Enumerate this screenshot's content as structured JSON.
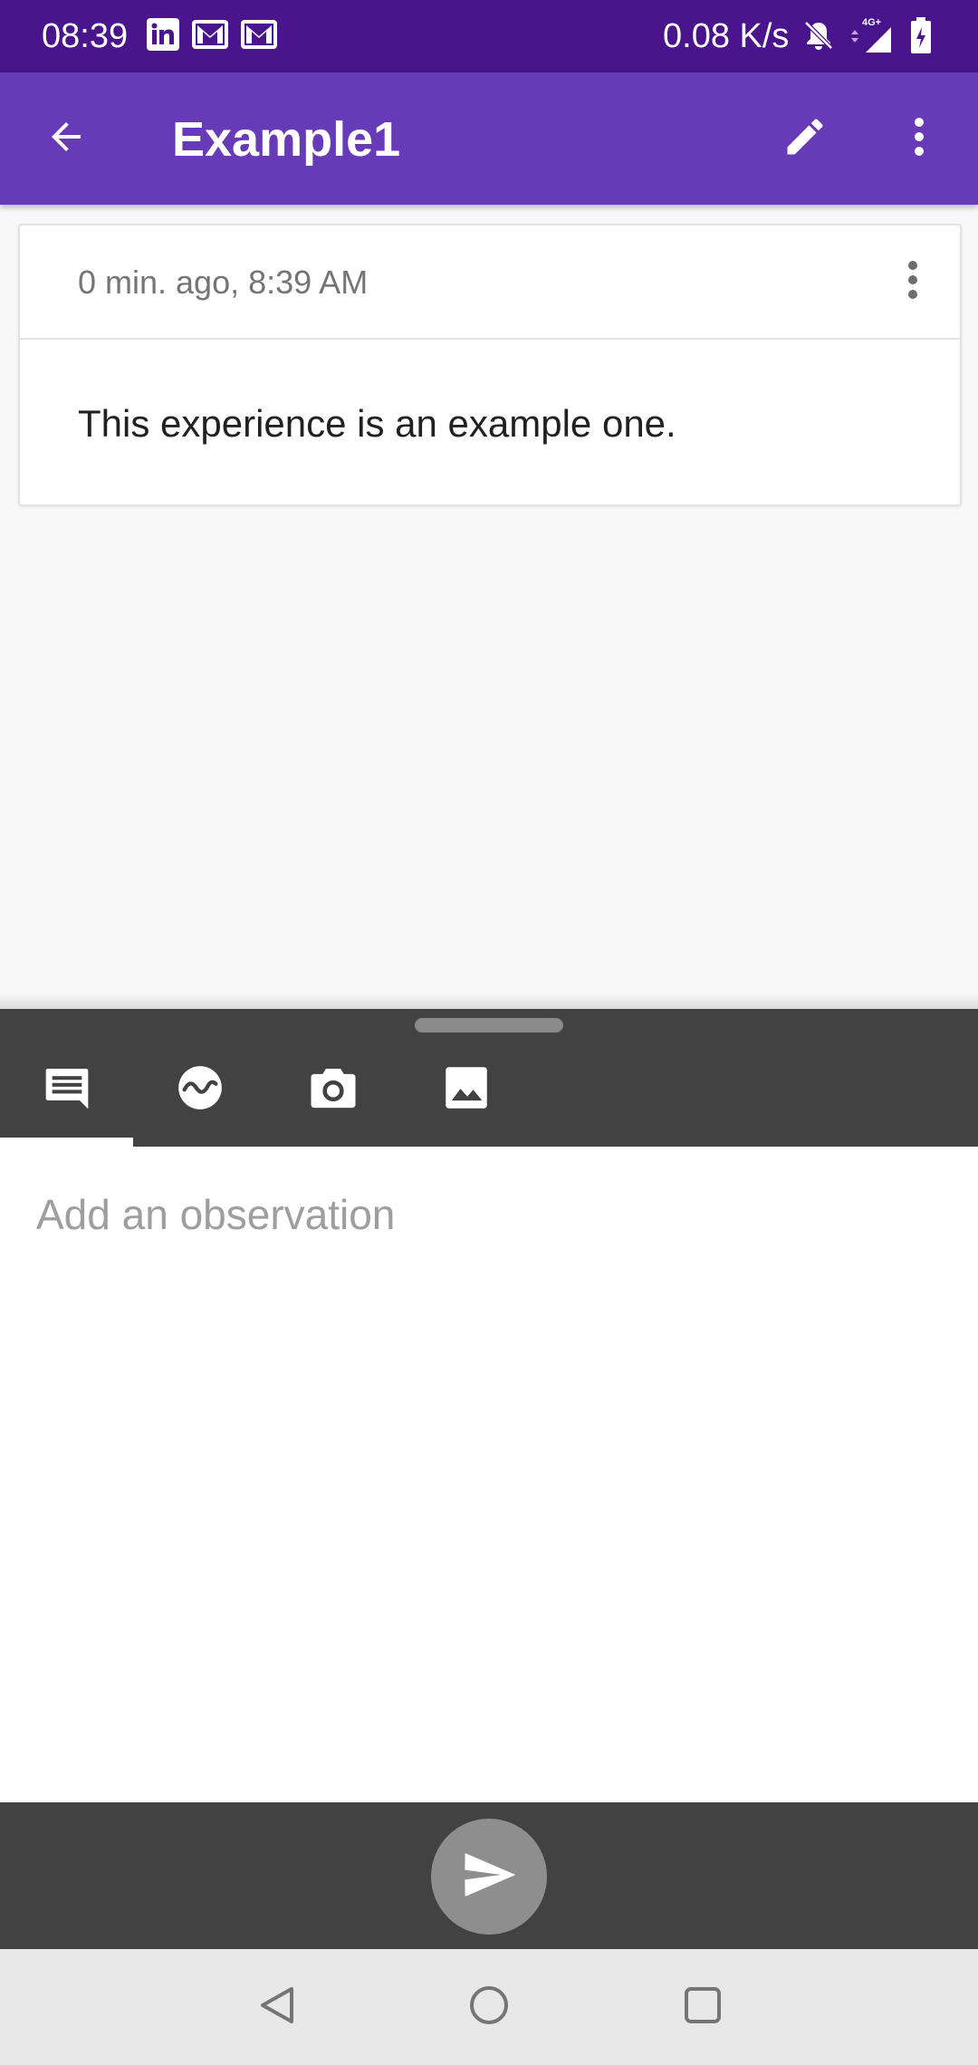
{
  "status_bar": {
    "time": "08:39",
    "network_speed": "0.08 K/s",
    "network_type": "4G+",
    "left_icons": [
      "linkedin-icon",
      "gmail-icon",
      "gmail-icon"
    ],
    "right_icons": [
      "bell-off-icon",
      "signal-icon",
      "battery-charging-icon"
    ]
  },
  "app_bar": {
    "title": "Example1",
    "back_icon": "arrow-left-icon",
    "edit_icon": "pencil-icon",
    "overflow_icon": "more-vertical-icon"
  },
  "card": {
    "timestamp": "0 min. ago, 8:39 AM",
    "text": "This experience is an example one.",
    "menu_icon": "more-vertical-icon"
  },
  "toolbar": {
    "tabs": [
      {
        "icon": "comment-icon",
        "selected": true
      },
      {
        "icon": "sensor-wave-icon",
        "selected": false
      },
      {
        "icon": "camera-icon",
        "selected": false
      },
      {
        "icon": "image-icon",
        "selected": false
      }
    ]
  },
  "observation": {
    "placeholder": "Add an observation",
    "value": ""
  },
  "send": {
    "icon": "send-icon"
  },
  "nav_bar": {
    "buttons": [
      "back-triangle-icon",
      "home-circle-icon",
      "recents-square-icon"
    ]
  },
  "colors": {
    "status_bar": "#4a148c",
    "app_bar": "#673ab7",
    "toolbar": "#424242",
    "send_button": "#8e8e8e",
    "nav_bar": "#e8e8e8"
  }
}
